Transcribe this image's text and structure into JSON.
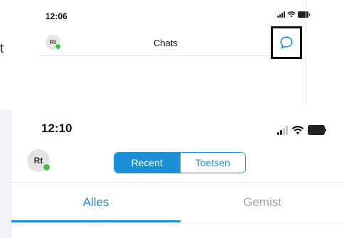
{
  "top_shot": {
    "edge_letter": "t",
    "status_bar": {
      "time": "12:06",
      "signal_icon": "signal-bars-icon",
      "wifi_icon": "wifi-icon",
      "battery_icon": "battery-icon"
    },
    "avatar_initials": "Rt",
    "title": "Chats",
    "new_chat_icon": "chat-bubble-icon",
    "highlight_color": "#111111"
  },
  "bottom_shot": {
    "status_bar": {
      "time": "12:10",
      "signal_icon": "signal-bars-icon",
      "wifi_icon": "wifi-icon",
      "battery_icon": "battery-icon"
    },
    "avatar_initials": "Rt",
    "segmented": {
      "options": [
        "Recent",
        "Toetsen"
      ],
      "selected": "Recent"
    },
    "tabs": [
      {
        "label": "Alles",
        "active": true
      },
      {
        "label": "Gemist",
        "active": false
      }
    ]
  },
  "colors": {
    "accent": "#1a8fd6",
    "presence_online": "#3cc23c",
    "inactive_tab": "#a4a4a4"
  }
}
